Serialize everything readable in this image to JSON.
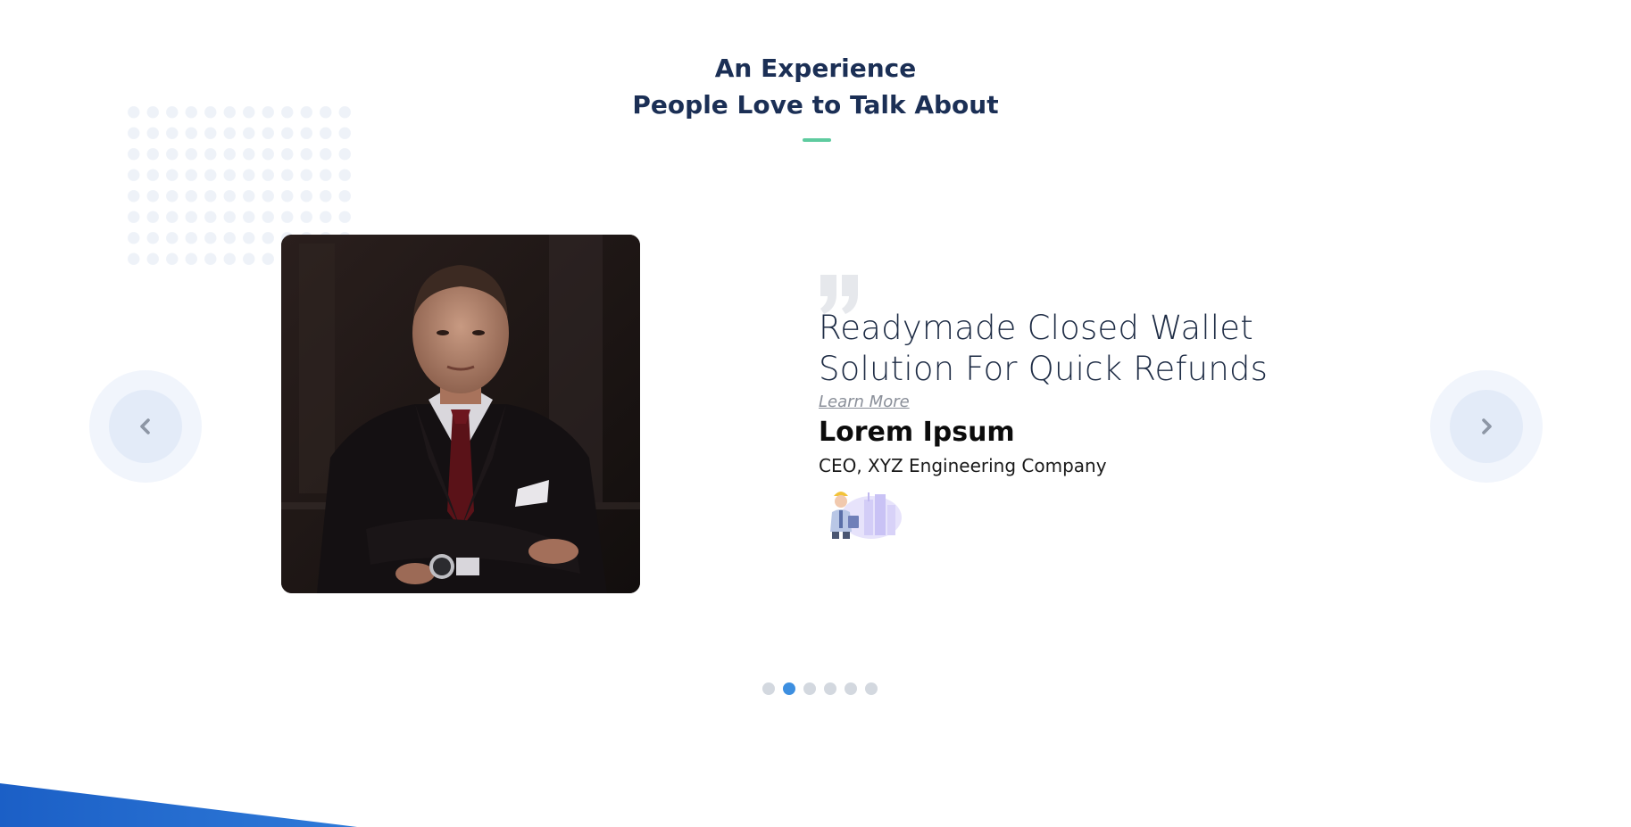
{
  "section": {
    "title_line1": "An Experience",
    "title_line2": "People Love to Talk About"
  },
  "testimonial": {
    "quote_line1": "Readymade Closed Wallet",
    "quote_line2": "Solution For Quick Refunds",
    "learn_more": "Learn More",
    "name": "Lorem Ipsum",
    "role": "CEO, XYZ Engineering Company"
  },
  "carousel": {
    "total_slides": 6,
    "active_index": 1
  },
  "icons": {
    "prev": "chevron-left-icon",
    "next": "chevron-right-icon",
    "quote": "quote-icon"
  },
  "colors": {
    "heading": "#1b2f55",
    "accent_underline": "#5ecb9f",
    "active_dot": "#3d8fe0",
    "inactive_dot": "#d3d8df",
    "wedge": "#1e63c8"
  }
}
